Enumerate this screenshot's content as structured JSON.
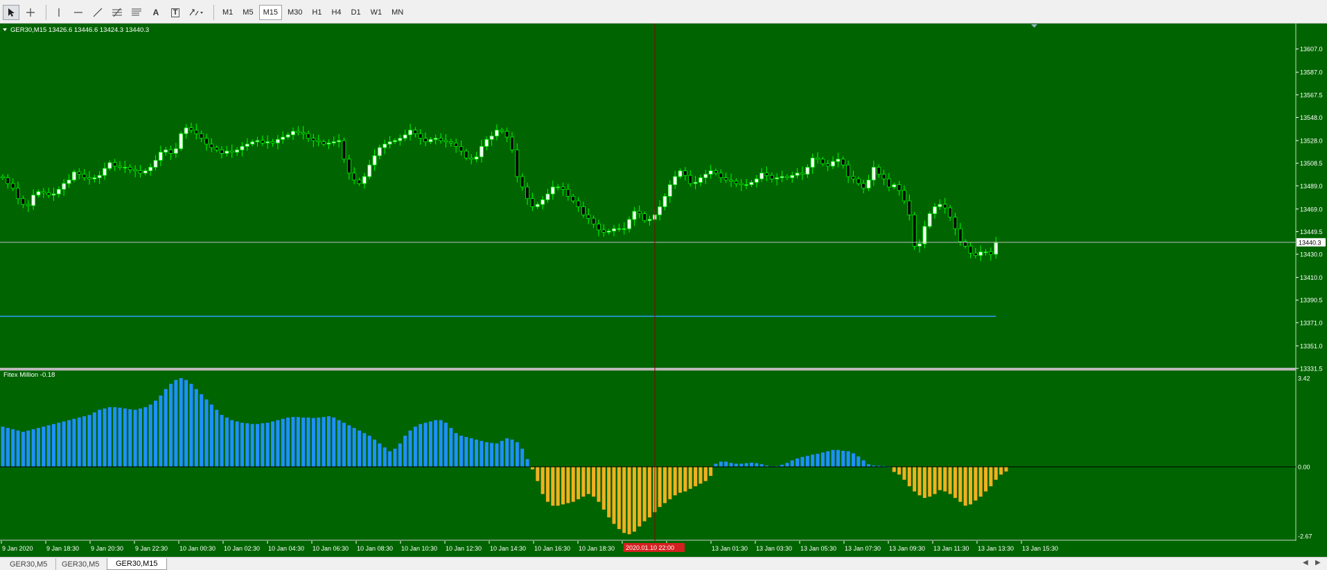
{
  "toolbar": {
    "tools": [
      {
        "name": "cursor",
        "icon": "cursor-icon",
        "active": true
      },
      {
        "name": "crosshair",
        "icon": "crosshair-icon",
        "active": false
      },
      {
        "name": "vertical-line",
        "icon": "vertical-line-icon",
        "active": false
      },
      {
        "name": "horizontal-line",
        "icon": "horizontal-line-icon",
        "active": false
      },
      {
        "name": "trendline",
        "icon": "trendline-icon",
        "active": false
      },
      {
        "name": "fibonacci",
        "icon": "fibonacci-icon",
        "active": false
      },
      {
        "name": "channel",
        "icon": "channel-icon",
        "active": false
      },
      {
        "name": "text",
        "icon": "text-icon",
        "glyph": "A",
        "active": false
      },
      {
        "name": "text-label",
        "icon": "text-label-icon",
        "glyph": "T",
        "active": false
      },
      {
        "name": "arrows",
        "icon": "arrows-icon",
        "active": false
      }
    ],
    "timeframes": [
      "M1",
      "M5",
      "M15",
      "M30",
      "H1",
      "H4",
      "D1",
      "W1",
      "MN"
    ],
    "active_timeframe": "M15"
  },
  "chart": {
    "header": "GER30,M15  13426.6 13446.6 13424.3 13440.3",
    "indicator_label": "Fitex Million -0.18",
    "current_price_label": "13440.3",
    "current_price": 13440.3,
    "support_price": 13376.5,
    "price_axis": [
      "13607.0",
      "13587.0",
      "13567.5",
      "13548.0",
      "13528.0",
      "13508.5",
      "13489.0",
      "13469.0",
      "13449.5",
      "13430.0",
      "13410.0",
      "13390.5",
      "13371.0",
      "13351.0",
      "13331.5"
    ],
    "indicator_axis": [
      "3.42",
      "0.00",
      "-2.67"
    ],
    "time_axis": [
      "9 Jan 2020",
      "9 Jan 18:30",
      "9 Jan 20:30",
      "9 Jan 22:30",
      "10 Jan 00:30",
      "10 Jan 02:30",
      "10 Jan 04:30",
      "10 Jan 06:30",
      "10 Jan 08:30",
      "10 Jan 10:30",
      "10 Jan 12:30",
      "10 Jan 14:30",
      "10 Jan 16:30",
      "10 Jan 18:30",
      "10",
      "23:30",
      "13 Jan 01:30",
      "13 Jan 03:30",
      "13 Jan 05:30",
      "13 Jan 07:30",
      "13 Jan 09:30",
      "13 Jan 11:30",
      "13 Jan 13:30",
      "13 Jan 15:30"
    ],
    "crosshair_label": "2020.01.10 22:00",
    "colors": {
      "background": "#006400",
      "bull_candle": "#ffffff",
      "bear_candle": "#000000",
      "wick": "#00ff00",
      "histogram_positive": "#1e90ff",
      "histogram_negative": "#f0b020",
      "support_line": "#2aa0ff",
      "crosshair": "#8b0000",
      "axis_text": "#ffffff"
    }
  },
  "chart_data": [
    {
      "type": "candlestick",
      "series": [
        {
          "name": "GER30,M15",
          "close": [
            13496,
            13491,
            13487,
            13478,
            13473,
            13472,
            13481,
            13484,
            13483,
            13481,
            13482,
            13486,
            13491,
            13494,
            13501,
            13499,
            13496,
            13495,
            13496,
            13498,
            13504,
            13509,
            13506,
            13505,
            13505,
            13503,
            13502,
            13500,
            13502,
            13505,
            13511,
            13518,
            13520,
            13517,
            13521,
            13534,
            13539,
            13537,
            13534,
            13530,
            13525,
            13522,
            13520,
            13517,
            13519,
            13518,
            13520,
            13523,
            13525,
            13527,
            13528,
            13526,
            13527,
            13526,
            13529,
            13531,
            13533,
            13536,
            13535,
            13534,
            13530,
            13528,
            13527,
            13525,
            13526,
            13527,
            13528,
            13512,
            13500,
            13494,
            13491,
            13497,
            13507,
            13515,
            13522,
            13525,
            13527,
            13528,
            13530,
            13533,
            13537,
            13534,
            13530,
            13527,
            13529,
            13530,
            13528,
            13527,
            13526,
            13523,
            13519,
            13513,
            13512,
            13514,
            13523,
            13529,
            13532,
            13537,
            13536,
            13531,
            13520,
            13497,
            13488,
            13478,
            13471,
            13473,
            13477,
            13482,
            13488,
            13488,
            13486,
            13480,
            13476,
            13471,
            13464,
            13461,
            13456,
            13451,
            13449,
            13450,
            13452,
            13452,
            13452,
            13460,
            13467,
            13465,
            13459,
            13460,
            13464,
            13471,
            13480,
            13490,
            13497,
            13502,
            13498,
            13491,
            13492,
            13496,
            13499,
            13502,
            13500,
            13496,
            13494,
            13493,
            13491,
            13490,
            13490,
            13492,
            13495,
            13500,
            13498,
            13495,
            13496,
            13497,
            13496,
            13498,
            13500,
            13499,
            13505,
            13513,
            13512,
            13508,
            13506,
            13510,
            13512,
            13507,
            13497,
            13495,
            13491,
            13487,
            13494,
            13505,
            13499,
            13495,
            13488,
            13490,
            13485,
            13476,
            13464,
            13437,
            13439,
            13454,
            13465,
            13471,
            13473,
            13470,
            13462,
            13452,
            13441,
            13437,
            13431,
            13429,
            13432,
            13432,
            13430,
            13440
          ]
        }
      ],
      "price_range": [
        13331.5,
        13617.0
      ]
    },
    {
      "type": "bar",
      "series": [
        {
          "name": "Fitex Million",
          "values": [
            1.55,
            1.5,
            1.45,
            1.4,
            1.35,
            1.4,
            1.45,
            1.5,
            1.55,
            1.6,
            1.65,
            1.7,
            1.75,
            1.8,
            1.85,
            1.9,
            1.95,
            2.0,
            2.1,
            2.2,
            2.25,
            2.3,
            2.3,
            2.28,
            2.25,
            2.22,
            2.2,
            2.25,
            2.3,
            2.4,
            2.55,
            2.75,
            3.0,
            3.2,
            3.35,
            3.42,
            3.35,
            3.2,
            3.0,
            2.8,
            2.6,
            2.4,
            2.2,
            2.0,
            1.9,
            1.8,
            1.75,
            1.7,
            1.68,
            1.65,
            1.65,
            1.68,
            1.7,
            1.75,
            1.8,
            1.85,
            1.9,
            1.92,
            1.92,
            1.9,
            1.9,
            1.88,
            1.9,
            1.92,
            1.95,
            1.9,
            1.8,
            1.7,
            1.6,
            1.5,
            1.4,
            1.3,
            1.2,
            1.05,
            0.9,
            0.75,
            0.6,
            0.7,
            0.9,
            1.2,
            1.4,
            1.55,
            1.65,
            1.7,
            1.75,
            1.8,
            1.8,
            1.7,
            1.5,
            1.3,
            1.2,
            1.15,
            1.1,
            1.05,
            1.0,
            0.95,
            0.92,
            0.9,
            1.0,
            1.1,
            1.05,
            0.95,
            0.7,
            0.3,
            -0.1,
            -0.55,
            -1.05,
            -1.35,
            -1.5,
            -1.5,
            -1.45,
            -1.4,
            -1.35,
            -1.25,
            -1.15,
            -1.05,
            -1.15,
            -1.35,
            -1.65,
            -1.95,
            -2.2,
            -2.4,
            -2.55,
            -2.6,
            -2.5,
            -2.3,
            -2.1,
            -1.95,
            -1.75,
            -1.55,
            -1.4,
            -1.25,
            -1.1,
            -1.0,
            -0.95,
            -0.85,
            -0.75,
            -0.65,
            -0.55,
            -0.35,
            0.12,
            0.2,
            0.2,
            0.15,
            0.12,
            0.12,
            0.14,
            0.16,
            0.14,
            0.1,
            0.05,
            0.02,
            0.03,
            0.08,
            0.15,
            0.25,
            0.32,
            0.38,
            0.42,
            0.47,
            0.5,
            0.55,
            0.6,
            0.65,
            0.65,
            0.62,
            0.6,
            0.52,
            0.4,
            0.25,
            0.1,
            0.05,
            0.04,
            0.03,
            0.0,
            -0.2,
            -0.3,
            -0.5,
            -0.75,
            -0.95,
            -1.1,
            -1.2,
            -1.15,
            -1.05,
            -0.9,
            -0.95,
            -1.05,
            -1.2,
            -1.35,
            -1.5,
            -1.45,
            -1.3,
            -1.15,
            -0.95,
            -0.75,
            -0.5,
            -0.3,
            -0.18
          ]
        }
      ],
      "ylim": [
        -2.67,
        3.42
      ]
    }
  ],
  "tabs": [
    "GER30,M5",
    "GER30,M5",
    "GER30,M15"
  ],
  "active_tab": 2
}
